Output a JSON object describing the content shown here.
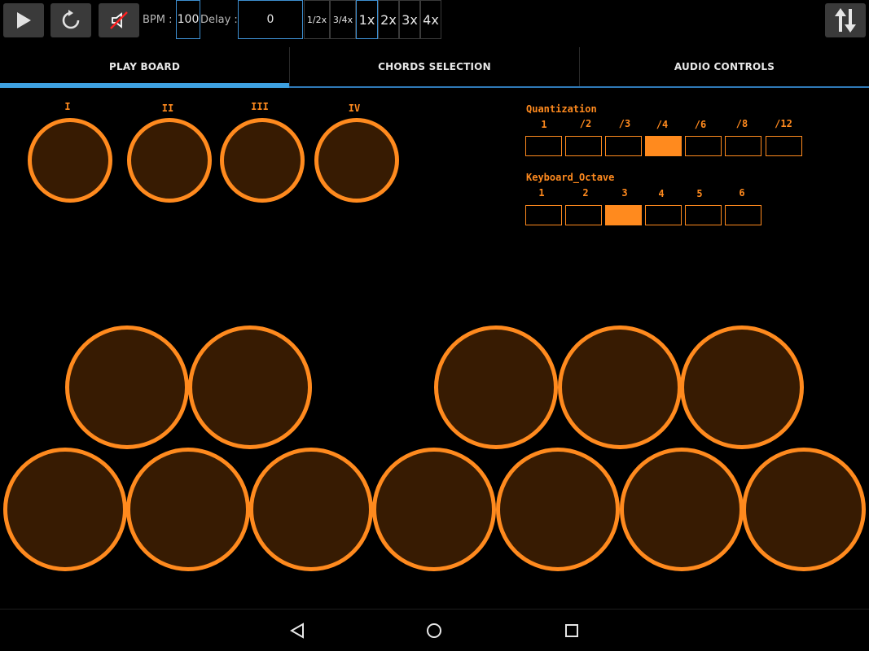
{
  "toolbar": {
    "bpm_label": "BPM :",
    "bpm_value": "100",
    "delay_label": "Delay :",
    "delay_value": "0",
    "speed_options": [
      "1/2x",
      "3/4x",
      "1x",
      "2x",
      "3x",
      "4x"
    ],
    "speed_selected": "1x",
    "icons": [
      "play-icon",
      "reset-icon",
      "mute-icon",
      "sort-arrows-icon"
    ]
  },
  "tabs": [
    {
      "label": "PLAY BOARD",
      "active": true
    },
    {
      "label": "CHORDS SELECTION",
      "active": false
    },
    {
      "label": "AUDIO CONTROLS",
      "active": false
    }
  ],
  "chords": [
    "I",
    "II",
    "III",
    "IV"
  ],
  "quantization": {
    "title": "Quantization",
    "options": [
      "1",
      "/2",
      "/3",
      "/4",
      "/6",
      "/8",
      "/12"
    ],
    "selected": "/4"
  },
  "keyboard_octave": {
    "title": "Keyboard_Octave",
    "options": [
      "1",
      "2",
      "3",
      "4",
      "5",
      "6"
    ],
    "selected": "3"
  },
  "colors": {
    "accent": "#ff8a1e",
    "pad_fill": "#371b02",
    "tab_indicator": "#3ea0e0",
    "box_border": "#3d8fd1"
  },
  "navbar": {
    "icons": [
      "back-icon",
      "home-icon",
      "recents-icon"
    ]
  }
}
